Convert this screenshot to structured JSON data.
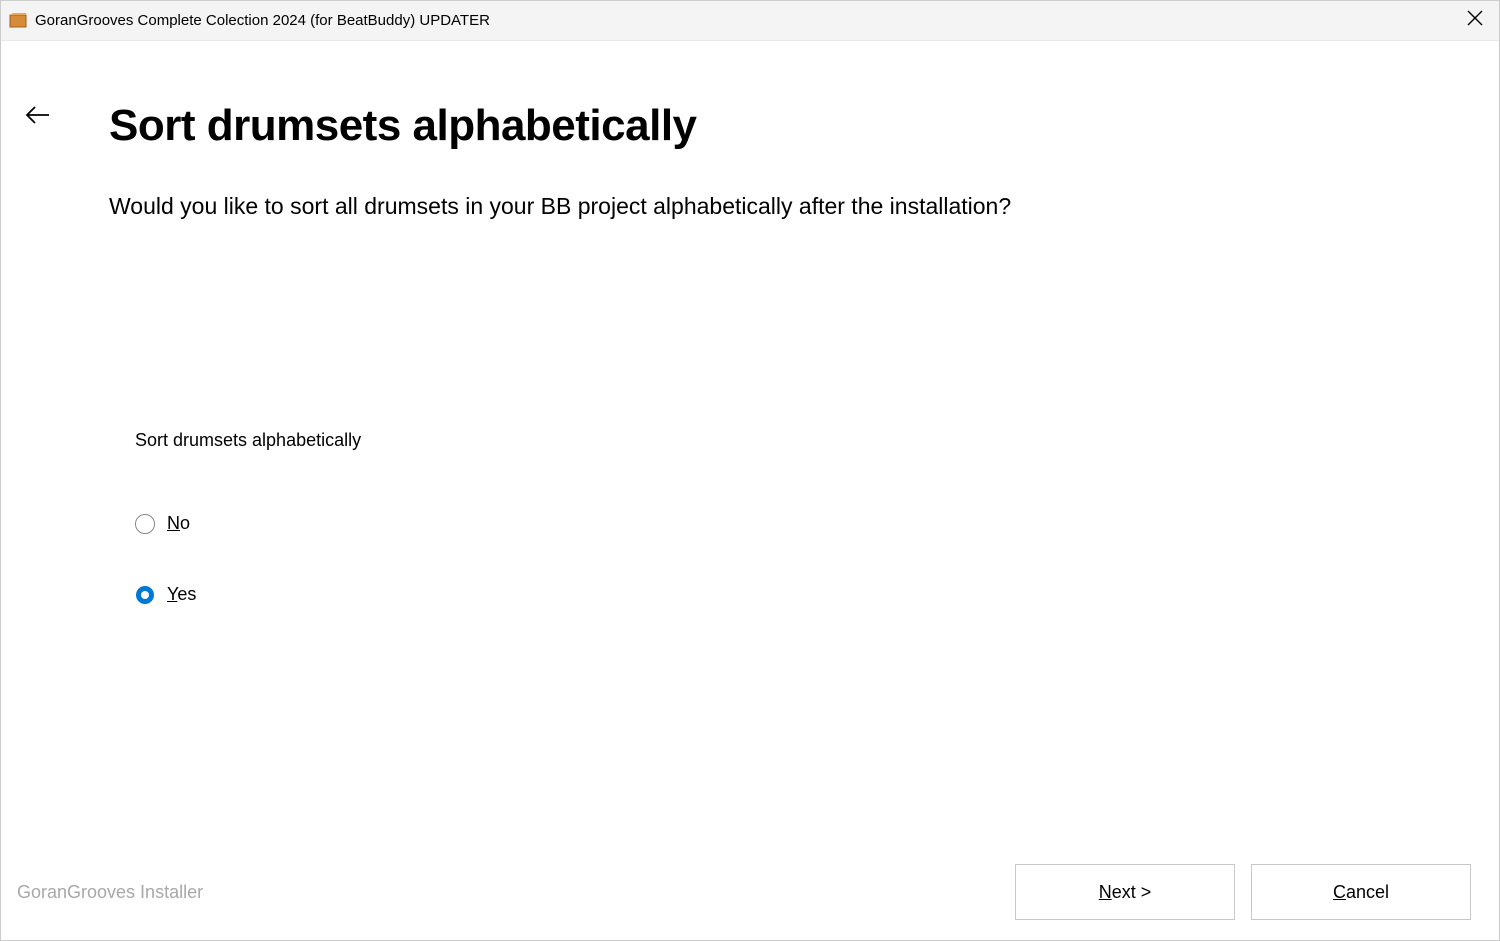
{
  "window": {
    "title": "GoranGrooves Complete Colection 2024 (for BeatBuddy) UPDATER"
  },
  "page": {
    "title": "Sort drumsets alphabetically",
    "subtitle": "Would you like to sort all drumsets in your BB project alphabetically after the installation?",
    "group_label": "Sort drumsets alphabetically"
  },
  "options": {
    "no": {
      "label": "No",
      "accesskey": "N",
      "rest": "o",
      "selected": false
    },
    "yes": {
      "label": "Yes",
      "accesskey": "Y",
      "rest": "es",
      "selected": true
    }
  },
  "footer": {
    "brand": "GoranGrooves Installer",
    "next": {
      "accesskey": "N",
      "rest": "ext >"
    },
    "cancel": {
      "accesskey": "C",
      "rest": "ancel"
    }
  },
  "colors": {
    "accent": "#0078d7"
  }
}
